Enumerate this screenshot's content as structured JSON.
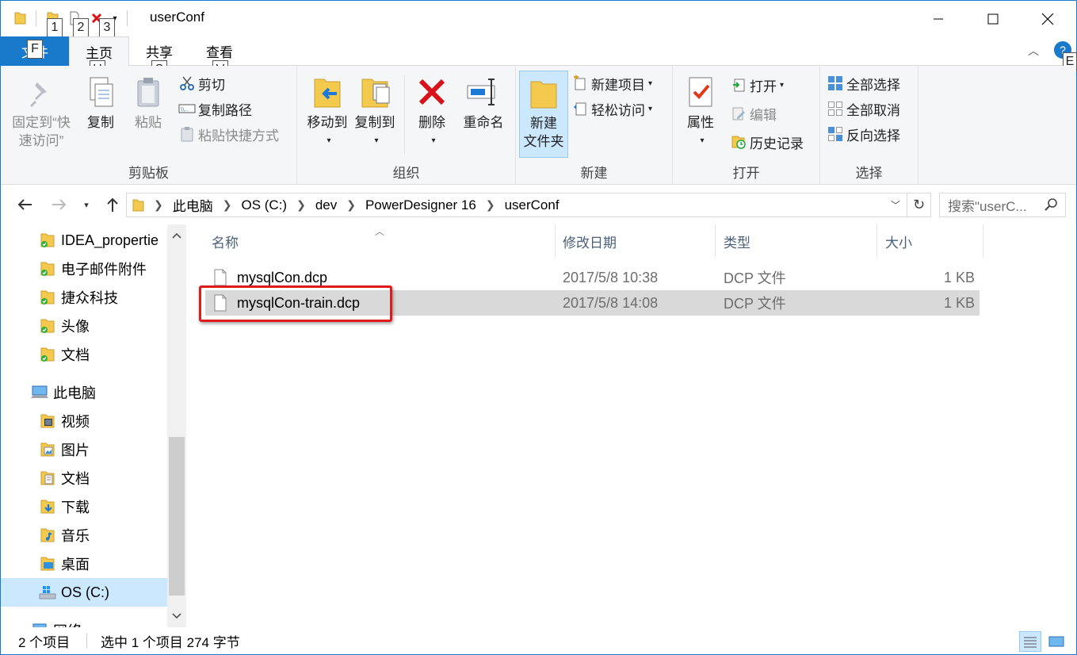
{
  "window": {
    "title": "userConf",
    "keytips": [
      "1",
      "2",
      "3"
    ]
  },
  "tabs": {
    "file": "文件",
    "file_keytip": "F",
    "home": "主页",
    "home_keytip": "H",
    "share": "共享",
    "share_keytip": "S",
    "view": "查看",
    "view_keytip": "V",
    "help_keytip": "E"
  },
  "ribbon": {
    "clipboard": {
      "pin_line1": "固定到“快",
      "pin_line2": "速访问”",
      "copy": "复制",
      "paste": "粘贴",
      "cut": "剪切",
      "copy_path": "复制路径",
      "paste_shortcut": "粘贴快捷方式",
      "label": "剪贴板"
    },
    "organize": {
      "move_to": "移动到",
      "copy_to": "复制到",
      "delete": "删除",
      "rename": "重命名",
      "label": "组织"
    },
    "new": {
      "new_folder_line1": "新建",
      "new_folder_line2": "文件夹",
      "new_item": "新建项目",
      "easy_access": "轻松访问",
      "label": "新建"
    },
    "open": {
      "properties": "属性",
      "open": "打开",
      "edit": "编辑",
      "history": "历史记录",
      "label": "打开"
    },
    "select": {
      "select_all": "全部选择",
      "select_none": "全部取消",
      "invert": "反向选择",
      "label": "选择"
    }
  },
  "address": {
    "crumbs": [
      "此电脑",
      "OS (C:)",
      "dev",
      "PowerDesigner 16",
      "userConf"
    ],
    "search_placeholder": "搜索\"userC..."
  },
  "navpane": {
    "items": [
      {
        "label": "IDEA_propertie"
      },
      {
        "label": "电子邮件附件"
      },
      {
        "label": "捷众科技"
      },
      {
        "label": "头像"
      },
      {
        "label": "文档"
      },
      {
        "label": "此电脑"
      },
      {
        "label": "视频"
      },
      {
        "label": "图片"
      },
      {
        "label": "文档"
      },
      {
        "label": "下载"
      },
      {
        "label": "音乐"
      },
      {
        "label": "桌面"
      },
      {
        "label": "OS (C:)"
      },
      {
        "label": "网络"
      }
    ]
  },
  "filelist": {
    "columns": [
      "名称",
      "修改日期",
      "类型",
      "大小"
    ],
    "rows": [
      {
        "name": "mysqlCon.dcp",
        "date": "2017/5/8 10:38",
        "type": "DCP 文件",
        "size": "1 KB"
      },
      {
        "name": "mysqlCon-train.dcp",
        "date": "2017/5/8 14:08",
        "type": "DCP 文件",
        "size": "1 KB"
      }
    ]
  },
  "status": {
    "count": "2 个项目",
    "selection": "选中 1 个项目  274 字节"
  },
  "colors": {
    "accent": "#1979ca",
    "selection": "#d9d9d9",
    "highlight_box": "#e01b1b",
    "folder": "#f3c94e"
  }
}
